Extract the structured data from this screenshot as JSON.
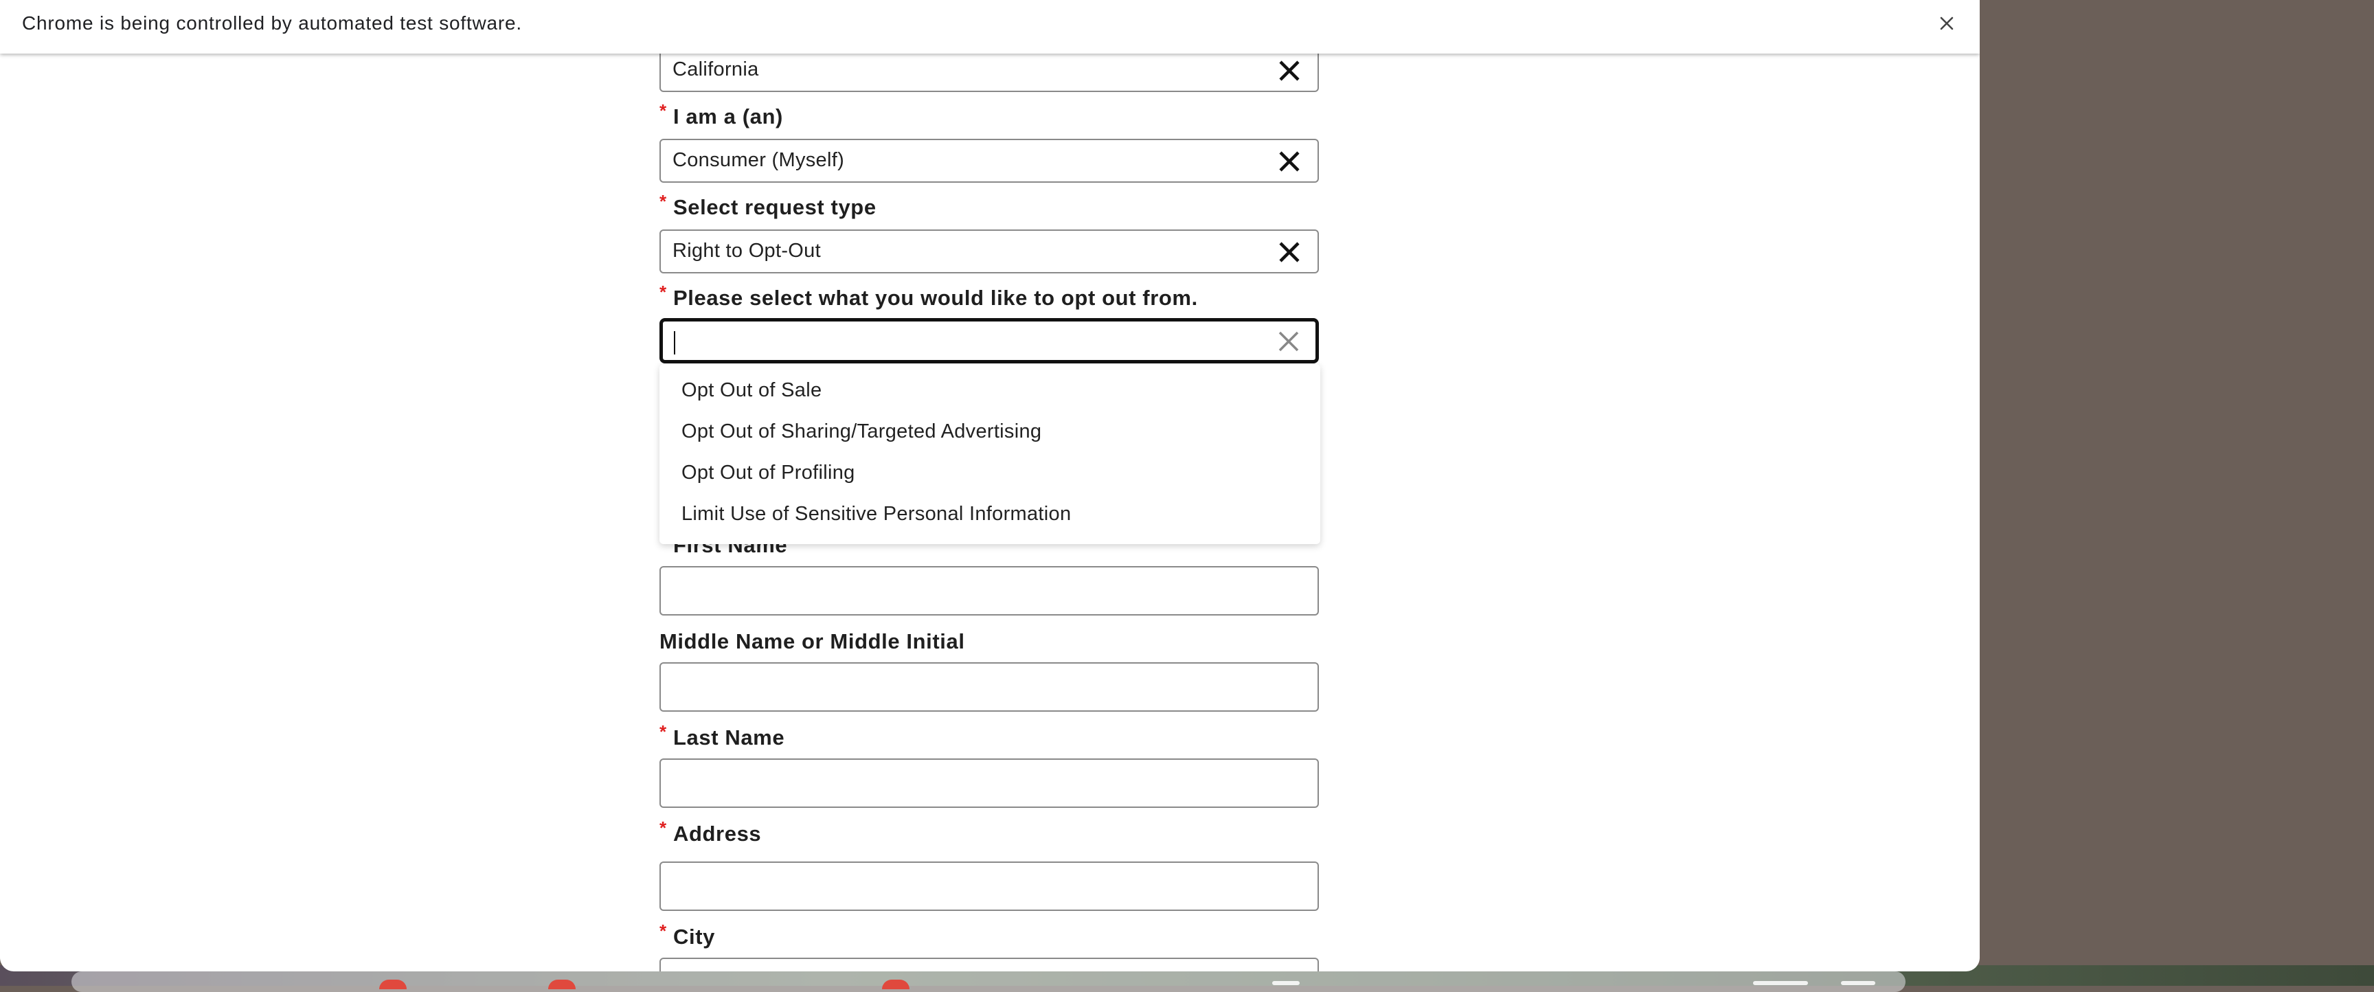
{
  "browser": {
    "infobar_text": "Chrome is being controlled by automated test software.",
    "close_icon": "close-icon"
  },
  "form": {
    "required_marker": "*",
    "state": {
      "value": "California"
    },
    "i_am": {
      "label": "I am a (an)",
      "value": "Consumer (Myself)"
    },
    "request_type": {
      "label": "Select request type",
      "value": "Right to Opt-Out"
    },
    "opt_out_from": {
      "label": "Please select what you would like to opt out from.",
      "value": "",
      "options": [
        "Opt Out of Sale",
        "Opt Out of Sharing/Targeted Advertising",
        "Opt Out of Profiling",
        "Limit Use of Sensitive Personal Information"
      ]
    },
    "first_name": {
      "label": "First Name",
      "value": ""
    },
    "middle_name": {
      "label": "Middle Name or Middle Initial",
      "value": ""
    },
    "last_name": {
      "label": "Last Name",
      "value": ""
    },
    "address": {
      "label": "Address",
      "value": ""
    },
    "city": {
      "label": "City",
      "value": ""
    }
  },
  "colors": {
    "required": "#e02020",
    "focus_border": "#111111",
    "input_border": "#8a8a8a"
  }
}
